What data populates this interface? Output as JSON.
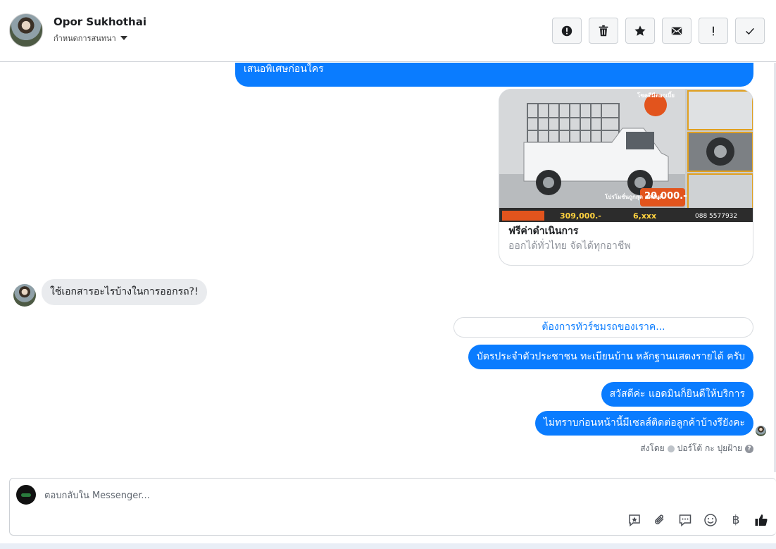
{
  "header": {
    "contact_name": "Opor Sukhothai",
    "subtitle": "กำหนดการสนทนา",
    "actions": [
      {
        "name": "report-button",
        "icon": "alert-circle-icon"
      },
      {
        "name": "delete-button",
        "icon": "trash-icon"
      },
      {
        "name": "star-button",
        "icon": "star-icon"
      },
      {
        "name": "mark-unread-button",
        "icon": "envelope-icon"
      },
      {
        "name": "important-button",
        "icon": "exclamation-icon"
      },
      {
        "name": "mark-done-button",
        "icon": "check-icon"
      }
    ]
  },
  "messages": {
    "top_outgoing": "เสนอพิเศษก่อนใคร",
    "card": {
      "title": "ฟรีค่าดำเนินการ",
      "description": "ออกได้ทั่วไทย จัดได้ทุกอาชีพ",
      "image_texts": {
        "badge": "โชคดีมีดอกเบี้ย",
        "promo": "โปรโมชั่นถูกสุด ลดทันที",
        "discount": "20,000.-",
        "price": "309,000.-",
        "down": "6,xxx",
        "phone": "088 5577932"
      }
    },
    "incoming": "ใช้เอกสารอะไรบ้างในการออกรถ?!",
    "quick_reply": "ต้องการทัวร์ชมรถของเราค...",
    "outgoing_1": "บัตรประจำตัวประชาชน ทะเบียนบ้าน หลักฐานแสดงรายได้ ครับ",
    "outgoing_2": "สวัสดีค่ะ แอดมินก็ยินดีให้บริการ",
    "outgoing_3": "ไม่ทราบก่อนหน้านี้มีเซลส์ติดต่อลูกค้าบ้างรึยังคะ",
    "sent_by_label": "ส่งโดย",
    "sent_by_name": "ปอร์โต้ กะ ปุยฝ้าย"
  },
  "composer": {
    "placeholder": "ตอบกลับใน Messenger...",
    "tools": [
      "saved-reply-icon",
      "attachment-icon",
      "chat-bubble-icon",
      "emoji-icon",
      "baht-icon",
      "like-icon"
    ],
    "baht_symbol": "฿"
  },
  "colors": {
    "accent": "#0a7cff",
    "incoming_bubble": "#e9ebee",
    "border": "#ccd0d5"
  }
}
